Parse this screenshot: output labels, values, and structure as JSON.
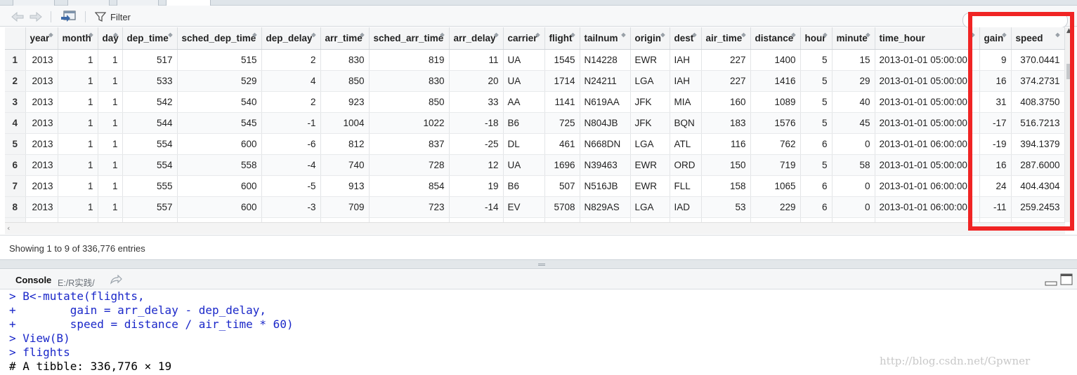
{
  "toolbar": {
    "filter_label": "Filter",
    "back_icon": "back-arrow-icon",
    "forward_icon": "forward-arrow-icon",
    "popout_icon": "popout-window-icon",
    "filter_icon": "filter-funnel-icon"
  },
  "table": {
    "columns": [
      {
        "label": "",
        "key": "rownum",
        "width": 29,
        "align": "center"
      },
      {
        "label": "year",
        "width": 46,
        "align": "num"
      },
      {
        "label": "month",
        "width": 57,
        "align": "num"
      },
      {
        "label": "day",
        "width": 35,
        "align": "num"
      },
      {
        "label": "dep_time",
        "width": 78,
        "align": "num"
      },
      {
        "label": "sched_dep_time",
        "width": 120,
        "align": "num"
      },
      {
        "label": "dep_delay",
        "width": 84,
        "align": "num"
      },
      {
        "label": "arr_time",
        "width": 69,
        "align": "num"
      },
      {
        "label": "sched_arr_time",
        "width": 114,
        "align": "num"
      },
      {
        "label": "arr_delay",
        "width": 77,
        "align": "num"
      },
      {
        "label": "carrier",
        "width": 59,
        "align": "txt"
      },
      {
        "label": "flight",
        "width": 50,
        "align": "num"
      },
      {
        "label": "tailnum",
        "width": 72,
        "align": "txt"
      },
      {
        "label": "origin",
        "width": 56,
        "align": "txt"
      },
      {
        "label": "dest",
        "width": 45,
        "align": "txt"
      },
      {
        "label": "air_time",
        "width": 70,
        "align": "num"
      },
      {
        "label": "distance",
        "width": 71,
        "align": "num"
      },
      {
        "label": "hour",
        "width": 45,
        "align": "num"
      },
      {
        "label": "minute",
        "width": 61,
        "align": "num"
      },
      {
        "label": "time_hour",
        "width": 149,
        "align": "txt"
      },
      {
        "label": "gain",
        "width": 45,
        "align": "num"
      },
      {
        "label": "speed",
        "width": 76,
        "align": "num"
      }
    ],
    "rows": [
      [
        "1",
        "2013",
        "1",
        "1",
        "517",
        "515",
        "2",
        "830",
        "819",
        "11",
        "UA",
        "1545",
        "N14228",
        "EWR",
        "IAH",
        "227",
        "1400",
        "5",
        "15",
        "2013-01-01 05:00:00",
        "9",
        "370.0441"
      ],
      [
        "2",
        "2013",
        "1",
        "1",
        "533",
        "529",
        "4",
        "850",
        "830",
        "20",
        "UA",
        "1714",
        "N24211",
        "LGA",
        "IAH",
        "227",
        "1416",
        "5",
        "29",
        "2013-01-01 05:00:00",
        "16",
        "374.2731"
      ],
      [
        "3",
        "2013",
        "1",
        "1",
        "542",
        "540",
        "2",
        "923",
        "850",
        "33",
        "AA",
        "1141",
        "N619AA",
        "JFK",
        "MIA",
        "160",
        "1089",
        "5",
        "40",
        "2013-01-01 05:00:00",
        "31",
        "408.3750"
      ],
      [
        "4",
        "2013",
        "1",
        "1",
        "544",
        "545",
        "-1",
        "1004",
        "1022",
        "-18",
        "B6",
        "725",
        "N804JB",
        "JFK",
        "BQN",
        "183",
        "1576",
        "5",
        "45",
        "2013-01-01 05:00:00",
        "-17",
        "516.7213"
      ],
      [
        "5",
        "2013",
        "1",
        "1",
        "554",
        "600",
        "-6",
        "812",
        "837",
        "-25",
        "DL",
        "461",
        "N668DN",
        "LGA",
        "ATL",
        "116",
        "762",
        "6",
        "0",
        "2013-01-01 06:00:00",
        "-19",
        "394.1379"
      ],
      [
        "6",
        "2013",
        "1",
        "1",
        "554",
        "558",
        "-4",
        "740",
        "728",
        "12",
        "UA",
        "1696",
        "N39463",
        "EWR",
        "ORD",
        "150",
        "719",
        "5",
        "58",
        "2013-01-01 05:00:00",
        "16",
        "287.6000"
      ],
      [
        "7",
        "2013",
        "1",
        "1",
        "555",
        "600",
        "-5",
        "913",
        "854",
        "19",
        "B6",
        "507",
        "N516JB",
        "EWR",
        "FLL",
        "158",
        "1065",
        "6",
        "0",
        "2013-01-01 06:00:00",
        "24",
        "404.4304"
      ],
      [
        "8",
        "2013",
        "1",
        "1",
        "557",
        "600",
        "-3",
        "709",
        "723",
        "-14",
        "EV",
        "5708",
        "N829AS",
        "LGA",
        "IAD",
        "53",
        "229",
        "6",
        "0",
        "2013-01-01 06:00:00",
        "-11",
        "259.2453"
      ],
      [
        "",
        "",
        "",
        "",
        "",
        "",
        "",
        "",
        "",
        "",
        "",
        "",
        "",
        "",
        "",
        "",
        "",
        "",
        "",
        "",
        "",
        ""
      ]
    ]
  },
  "status_text": "Showing 1 to 9 of 336,776 entries",
  "console": {
    "title": "Console",
    "path": "E:/R实践/",
    "lines": [
      {
        "text": "> B<-mutate(flights,",
        "kind": "cmd"
      },
      {
        "text": "+        gain = arr_delay - dep_delay,",
        "kind": "cmd"
      },
      {
        "text": "+        speed = distance / air_time * 60)",
        "kind": "cmd"
      },
      {
        "text": "> View(B)",
        "kind": "cmd"
      },
      {
        "text": "> flights",
        "kind": "cmd"
      },
      {
        "text": "# A tibble: 336,776 × 19",
        "kind": "out"
      }
    ]
  },
  "watermark": "http://blog.csdn.net/Gpwner",
  "colors": {
    "highlight": "#f02424",
    "console_command": "#1a27c9"
  }
}
